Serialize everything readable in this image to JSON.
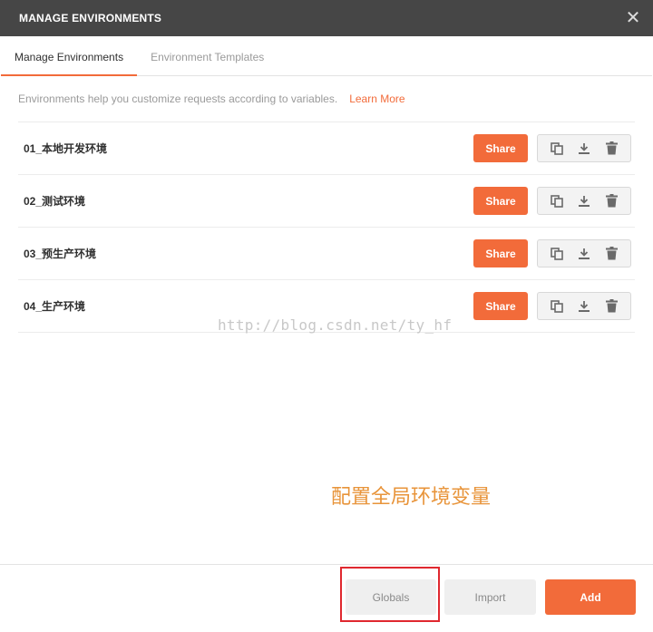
{
  "modal": {
    "title": "MANAGE ENVIRONMENTS",
    "close_icon": "close-icon"
  },
  "tabs": [
    {
      "label": "Manage Environments",
      "active": true
    },
    {
      "label": "Environment Templates",
      "active": false
    }
  ],
  "intro": {
    "text": "Environments help you customize requests according to variables.",
    "link": "Learn More"
  },
  "environments": [
    {
      "name": "01_本地开发环境",
      "share_label": "Share"
    },
    {
      "name": "02_测试环境",
      "share_label": "Share"
    },
    {
      "name": "03_预生产环境",
      "share_label": "Share"
    },
    {
      "name": "04_生产环境",
      "share_label": "Share"
    }
  ],
  "row_icons": [
    "duplicate-icon",
    "download-icon",
    "trash-icon"
  ],
  "watermark": "http://blog.csdn.net/ty_hf",
  "annotation": "配置全局环境变量",
  "footer": {
    "globals_label": "Globals",
    "import_label": "Import",
    "add_label": "Add"
  },
  "colors": {
    "accent": "#f26b3a",
    "header_bg": "#464646",
    "highlight": "#e0282f",
    "annotation": "#e8943a"
  }
}
